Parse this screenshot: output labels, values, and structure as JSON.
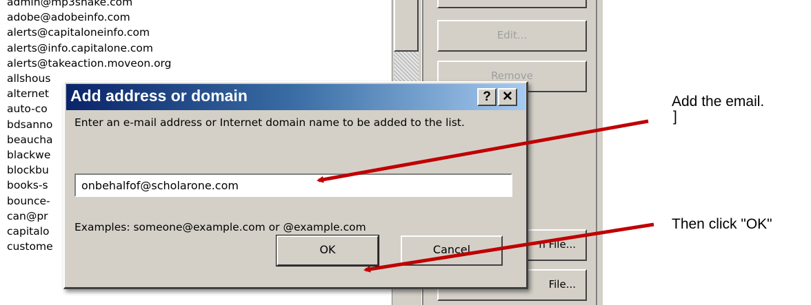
{
  "background_list": {
    "items": [
      "admin@mp3shake.com",
      "adobe@adobeinfo.com",
      "alerts@capitaloneinfo.com",
      "alerts@info.capitalone.com",
      "alerts@takeaction.moveon.org",
      "allshous",
      "alternet",
      "auto-co",
      "bdsanno",
      "beaucha",
      "blackwe",
      "blockbu",
      "books-s",
      "bounce-",
      "can@pr",
      "capitalo",
      "custome"
    ]
  },
  "right_panel": {
    "edit_label": "Edit...",
    "remove_label": "Remove",
    "import_label": "n File...",
    "export_label": "File..."
  },
  "dialog": {
    "title": "Add address or domain",
    "help_glyph": "?",
    "close_glyph": "✕",
    "instruction": "Enter an e-mail address or Internet domain name to be added to the list.",
    "input_value": "onbehalfof@scholarone.com",
    "examples": "Examples: someone@example.com or @example.com",
    "ok_label": "OK",
    "cancel_label": "Cancel"
  },
  "annotations": {
    "step1": "Add the email.",
    "step1_extra": "]",
    "step2": "Then click \"OK\"",
    "arrow_color": "#c00000"
  }
}
